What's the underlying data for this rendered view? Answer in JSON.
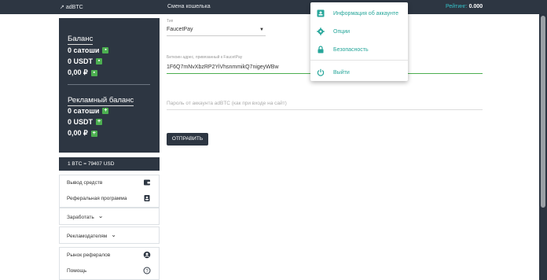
{
  "topbar": {
    "brand": "adBTC",
    "title": "Смена кошелька",
    "rating_label": "Рейтинг:",
    "rating_value": "0.000"
  },
  "balance": {
    "title": "Баланс",
    "items": [
      "0 сатоши",
      "0 USDT",
      "0,00 ₽"
    ],
    "ad_title": "Рекламный баланс",
    "ad_items": [
      "0 сатоши",
      "0 USDT",
      "0,00 ₽"
    ]
  },
  "rate": "1 BTC = 79407 USD",
  "menu": {
    "withdraw": "Вывод средств",
    "referral": "Реферальная программа",
    "earn": "Заработать",
    "advertisers": "Рекламодателям",
    "ref_market": "Рынок рефералов",
    "help": "Помощь"
  },
  "form": {
    "type_label": "Тип",
    "type_value": "FaucetPay",
    "address_label": "Биткоин адрес, привязанный к FaucetPay",
    "address_value": "1F6Q7mNvXbzRP2YiVhsnmmikQ7nigeyWBw",
    "password_placeholder": "Пароль от аккаунта adBTC (как при входе на сайт)",
    "submit": "ОТПРАВИТЬ"
  },
  "dropdown": {
    "items": [
      "Информация об аккаунте",
      "Опции",
      "Безопасность",
      "Выйти"
    ]
  },
  "colors": {
    "dark": "#2d3642",
    "accent": "#26a69a",
    "green": "#4caf50",
    "rating": "#35c0c7"
  }
}
